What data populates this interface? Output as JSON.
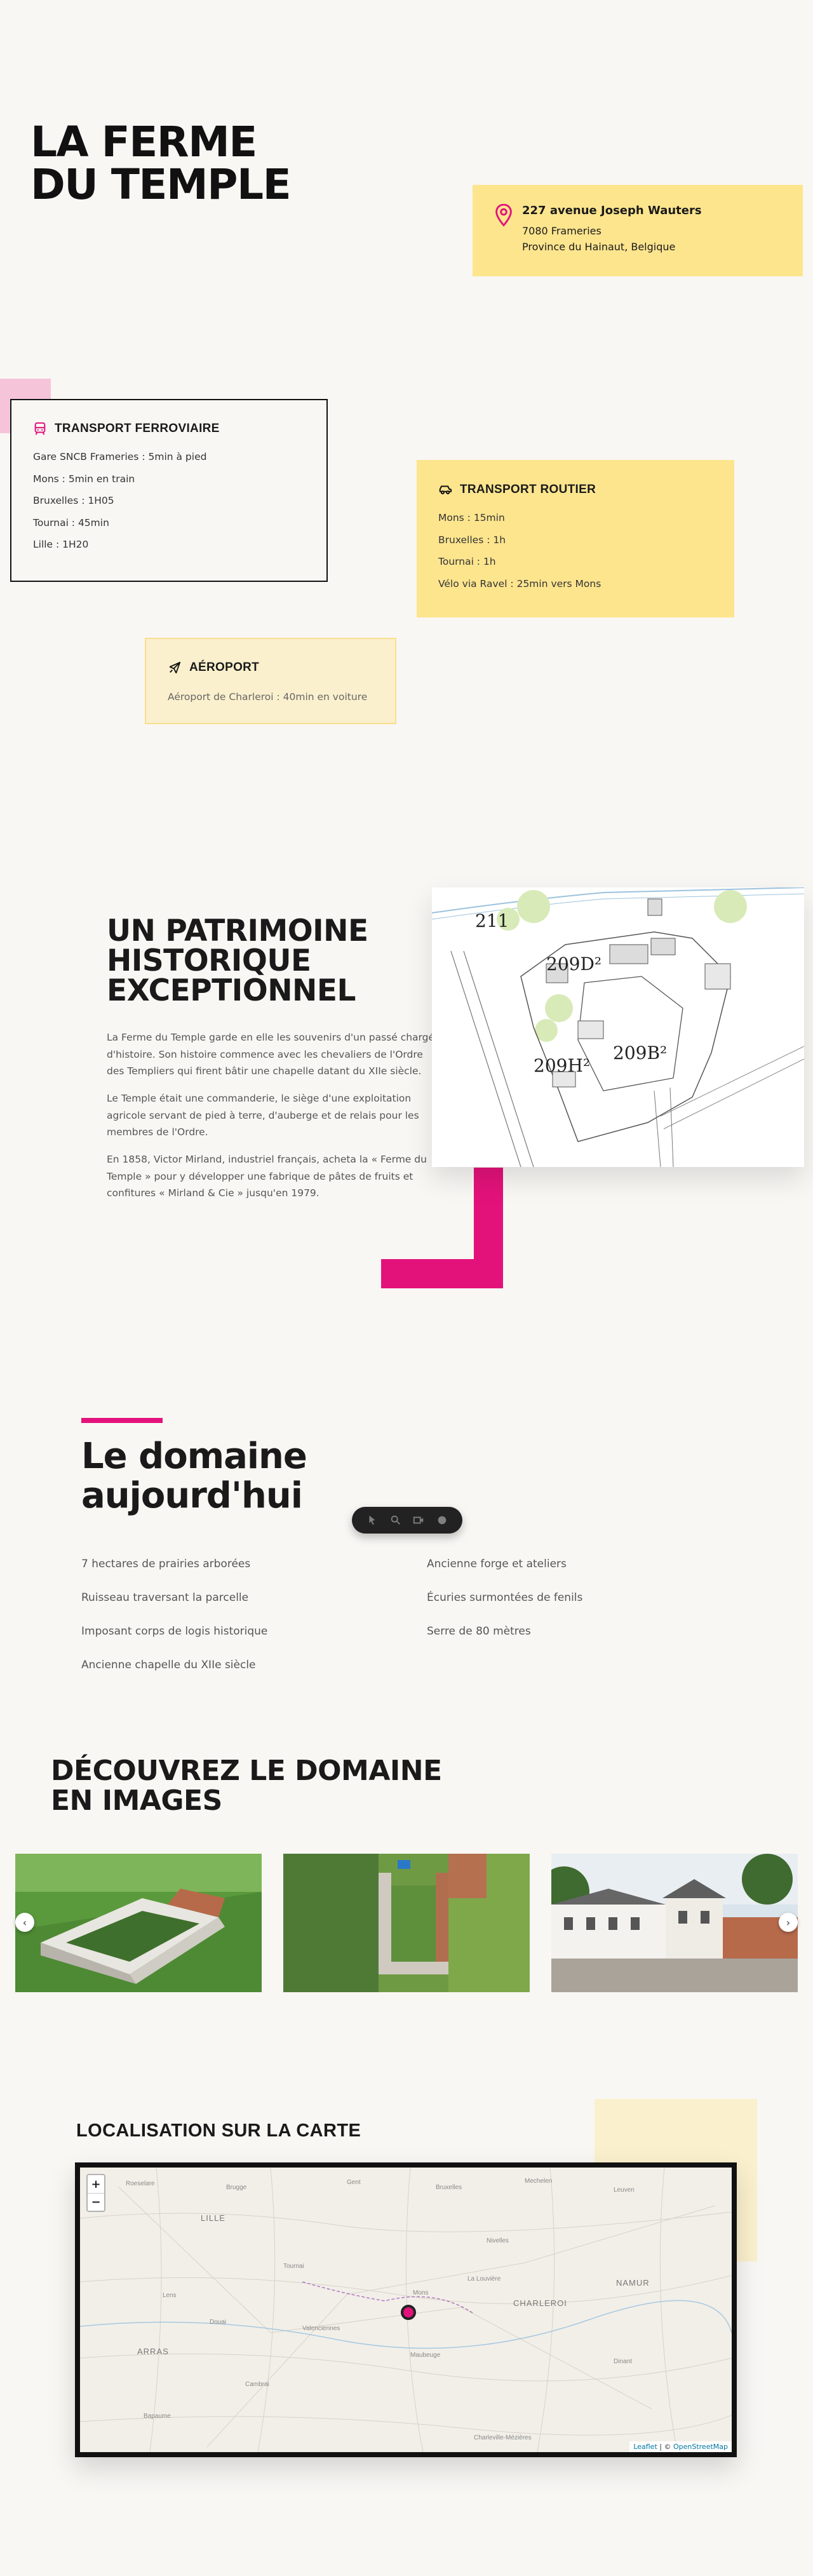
{
  "hero": {
    "title_line1": "LA FERME",
    "title_line2": "DU TEMPLE"
  },
  "address": {
    "street": "227 avenue Joseph Wauters",
    "city": "7080 Frameries",
    "province": "Province du Hainaut, Belgique",
    "icon": "location-pin-icon"
  },
  "transport_rail": {
    "title": "TRANSPORT FERROVIAIRE",
    "icon": "train-icon",
    "items": [
      "Gare SNCB Frameries : 5min à pied",
      "Mons : 5min en train",
      "Bruxelles : 1H05",
      "Tournai : 45min",
      "Lille : 1H20"
    ]
  },
  "transport_road": {
    "title": "TRANSPORT ROUTIER",
    "icon": "car-icon",
    "items": [
      "Mons : 15min",
      "Bruxelles : 1h",
      "Tournai : 1h",
      "Vélo via Ravel : 25min vers Mons"
    ]
  },
  "airport": {
    "title": "AÉROPORT",
    "icon": "plane-icon",
    "items": [
      "Aéroport de Charleroi : 40min en voiture"
    ]
  },
  "heritage": {
    "title_line1": "UN PATRIMOINE",
    "title_line2": "HISTORIQUE",
    "title_line3": "EXCEPTIONNEL",
    "paragraphs": [
      "La Ferme du Temple garde en elle les souvenirs d'un passé chargé d'histoire. Son histoire commence avec les chevaliers de l'Ordre des Templiers qui firent bâtir une chapelle datant du XIIe siècle.",
      "Le Temple était une commanderie, le siège d'une exploitation agricole servant de pied à terre, d'auberge et de relais pour les membres de l'Ordre.",
      "En 1858, Victor Mirland, industriel français, acheta la « Ferme du Temple » pour y développer une fabrique de pâtes de fruits et confitures « Mirland & Cie » jusqu'en 1979."
    ],
    "plan_labels": {
      "p1": "211",
      "p2": "209D²",
      "p3": "209H²",
      "p4": "209B²"
    }
  },
  "domain": {
    "title_line1": "Le domaine",
    "title_line2": "aujourd'hui",
    "features_left": [
      "7 hectares de prairies arborées",
      "Ruisseau traversant la parcelle",
      "Imposant corps de logis historique",
      "Ancienne chapelle du XIIe siècle"
    ],
    "features_right": [
      "Ancienne forge et ateliers",
      "Écuries surmontées de fenils",
      "Serre de 80 mètres"
    ]
  },
  "gallery": {
    "title_line1": "DÉCOUVREZ LE DOMAINE",
    "title_line2": "EN IMAGES",
    "prev": "‹",
    "next": "›"
  },
  "map": {
    "title": "LOCALISATION SUR LA CARTE",
    "zoom_in": "+",
    "zoom_out": "−",
    "attribution_leaflet": "Leaflet",
    "attribution_sep": " | © ",
    "attribution_osm": "OpenStreetMap",
    "labels": {
      "lille": "LILLE",
      "charleroi": "CHARLEROI",
      "namur": "NAMUR",
      "arras": "ARRAS",
      "roeselare": "Roeselare",
      "brugge": "Brugge",
      "gent": "Gent",
      "mons": "Mons",
      "tournai": "Tournai",
      "valenciennes": "Valenciennes",
      "douai": "Douai",
      "cambrai": "Cambrai",
      "maubeuge": "Maubeuge",
      "bruxelles": "Bruxelles",
      "mechelen": "Mechelen",
      "leuven": "Leuven",
      "dinant": "Dinant",
      "charleville": "Charleville-Mézières",
      "beauvais": "Bapaume",
      "lens": "Lens",
      "nivelles": "Nivelles",
      "la_louviere": "La Louvière"
    }
  },
  "colors": {
    "accent_pink": "#e3127b",
    "yellow": "#fde58e",
    "pale_yellow": "#fbf0cd"
  }
}
